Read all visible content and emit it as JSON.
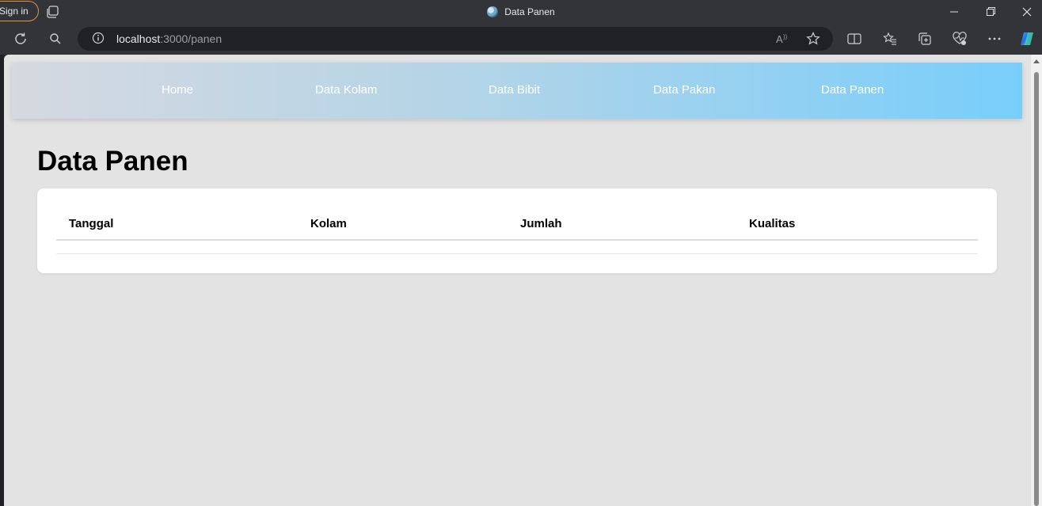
{
  "browser": {
    "sign_in_label": "Sign in",
    "tab_title": "Data Panen",
    "url_host": "localhost",
    "url_rest": ":3000/panen",
    "window_controls": [
      "minimize-icon",
      "restore-icon",
      "close-icon"
    ],
    "toolbar_icons": [
      "read-aloud-icon",
      "favorite-star-icon",
      "split-screen-icon",
      "favorites-icon",
      "collections-icon",
      "browser-essentials-icon",
      "more-icon",
      "copilot-icon"
    ]
  },
  "navbar": {
    "links": [
      "Home",
      "Data Kolam",
      "Data Bibit",
      "Data Pakan",
      "Data Panen"
    ]
  },
  "main": {
    "title": "Data Panen",
    "table": {
      "headers": [
        "Tanggal",
        "Kolam",
        "Jumlah",
        "Kualitas"
      ],
      "rows": []
    }
  },
  "colors": {
    "page_background": "#e3e3e3",
    "navbar_gradient_start": "#d5d9e0",
    "navbar_gradient_end": "#78cefb",
    "sign_in_border": "#e3914c"
  }
}
